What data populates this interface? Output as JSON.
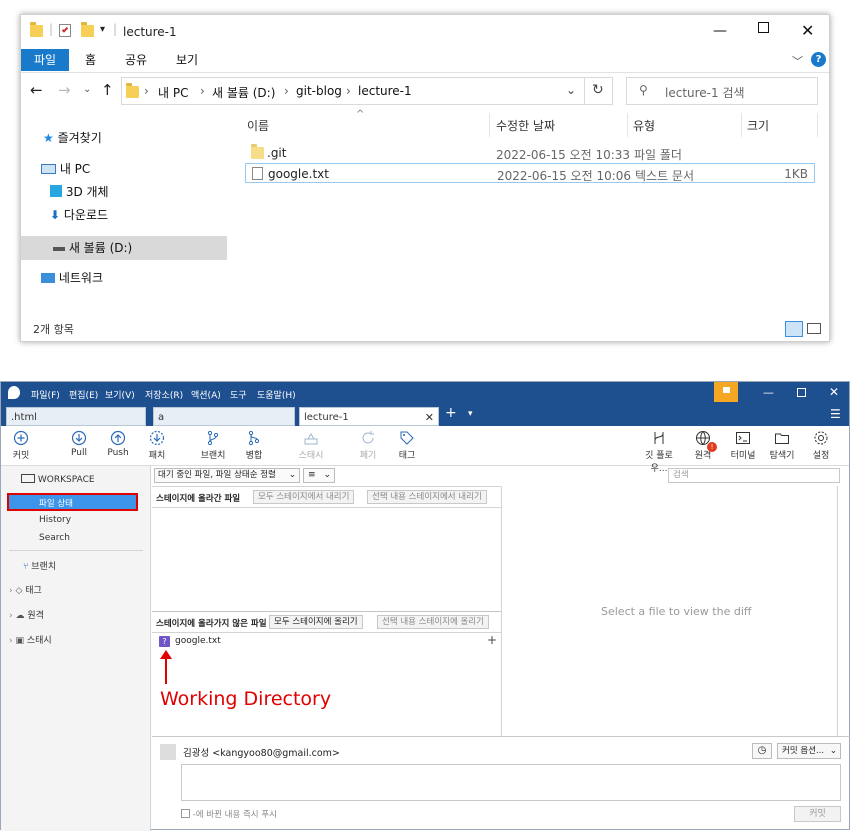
{
  "explorer": {
    "title": "lecture-1",
    "ribbon_tabs": [
      "파일",
      "홈",
      "공유",
      "보기"
    ],
    "address": [
      "내 PC",
      "새 볼륨 (D:)",
      "git-blog",
      "lecture-1"
    ],
    "search_placeholder": "lecture-1 검색",
    "nav": [
      "즐겨찾기",
      "내 PC",
      "3D 개체",
      "다운로드",
      "새 볼륨 (D:)",
      "네트워크"
    ],
    "columns": [
      "이름",
      "수정한 날짜",
      "유형",
      "크기"
    ],
    "files": [
      {
        "name": ".git",
        "date": "2022-06-15 오전 10:33",
        "type": "파일 폴더",
        "size": ""
      },
      {
        "name": "google.txt",
        "date": "2022-06-15 오전 10:06",
        "type": "텍스트 문서",
        "size": "1KB"
      }
    ],
    "status": "2개 항목",
    "accent": "#1979ca"
  },
  "sourcetree": {
    "menu": [
      "파일(F)",
      "편집(E)",
      "보기(V)",
      "저장소(R)",
      "액션(A)",
      "도구",
      "도움말(H)"
    ],
    "tabs": [
      ".html",
      "a",
      "lecture-1"
    ],
    "toolbar_left": [
      {
        "label": "커밋",
        "icon": "commit-icon"
      },
      {
        "label": "Pull",
        "icon": "pull-icon"
      },
      {
        "label": "Push",
        "icon": "push-icon"
      },
      {
        "label": "패치",
        "icon": "fetch-icon"
      },
      {
        "label": "브랜치",
        "icon": "branch-icon"
      },
      {
        "label": "병합",
        "icon": "merge-icon"
      },
      {
        "label": "스태시",
        "icon": "stash-icon"
      },
      {
        "label": "폐기",
        "icon": "discard-icon"
      },
      {
        "label": "태그",
        "icon": "tag-icon"
      }
    ],
    "toolbar_right": [
      {
        "label": "깃 플로우...",
        "icon": "gitflow-icon"
      },
      {
        "label": "원격",
        "icon": "remote-icon"
      },
      {
        "label": "터미널",
        "icon": "terminal-icon"
      },
      {
        "label": "탐색기",
        "icon": "explorer-icon"
      },
      {
        "label": "설정",
        "icon": "settings-icon"
      }
    ],
    "sidebar": {
      "workspace": "WORKSPACE",
      "items": [
        "파일 상태",
        "History",
        "Search"
      ],
      "sections": [
        "브랜치",
        "태그",
        "원격",
        "스태시"
      ]
    },
    "filter_dropdown": "대기 중인 파일, 파일 상태순 정렬",
    "search_placeholder": "검색",
    "staged": {
      "title": "스테이지에 올라간 파일",
      "btn_unstage_all": "모두 스테이지에서 내리기",
      "btn_unstage_sel": "선택 내용 스테이지에서 내리기"
    },
    "unstaged": {
      "title": "스테이지에 올라가지 않은 파일",
      "btn_stage_all": "모두 스테이지에 올리기",
      "btn_stage_sel": "선택 내용 스테이지에 올리기",
      "files": [
        "google.txt"
      ]
    },
    "diff_placeholder": "Select a file to view the diff",
    "annotation": "Working Directory",
    "annotation_color": "#e00000",
    "author": "김광성 <kangyoo80@gmail.com>",
    "commit_options": "커밋 옵션...",
    "push_immediately": "-에 바뀐 내용 즉시 푸시",
    "commit_button": "커밋",
    "header_color": "#1e4f8e"
  }
}
